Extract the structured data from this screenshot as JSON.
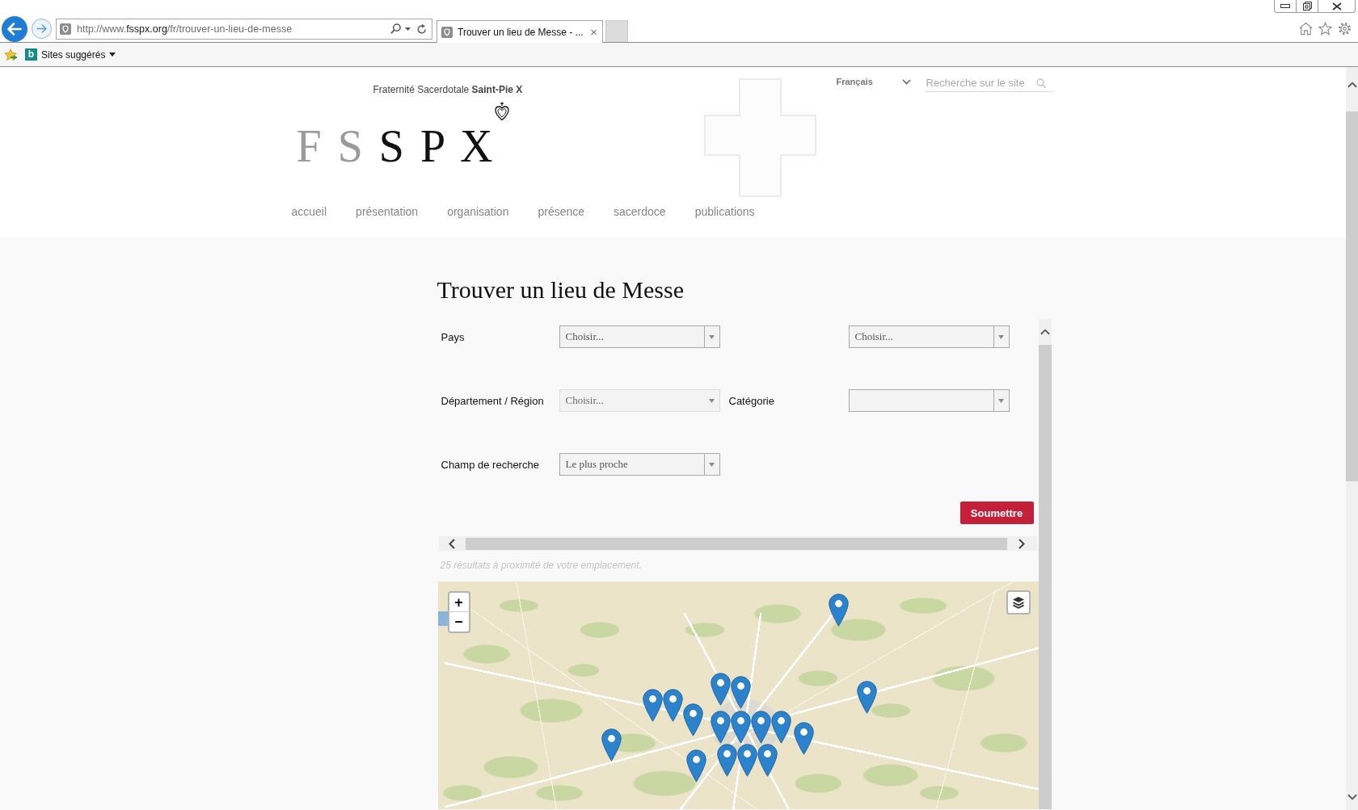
{
  "browser": {
    "address_bar": {
      "url": "http://www.fsspx.org/fr/trouver-un-lieu-de-messe"
    },
    "tabs": [
      {
        "label": "Trouver un lieu de Messe - ...",
        "close": "×",
        "selected": true
      }
    ],
    "favorites_bar": {
      "items": [
        {
          "icon_letter": "b",
          "label": "Sites suggérés"
        }
      ]
    }
  },
  "site_header": {
    "tagline": "Fraternité Sacerdotale **Saint-Pie X**",
    "logo": "F S S P X",
    "language": "Français",
    "search": {
      "placeholder": "Recherche sur le site"
    },
    "nav": [
      {
        "label": "accueil",
        "selected": false
      },
      {
        "label": "présentation",
        "selected": false
      },
      {
        "label": "organisation",
        "selected": false
      },
      {
        "label": "présence",
        "selected": false
      },
      {
        "label": "sacerdoce",
        "selected": false
      },
      {
        "label": "publications",
        "selected": false
      }
    ]
  },
  "page": {
    "title": "Trouver un lieu de Messe",
    "form": {
      "rows": [
        {
          "label": "Pays",
          "select": {
            "value": "Choisir...",
            "disabled": false
          },
          "extra_select": {
            "value": "Choisir...",
            "disabled": false
          }
        },
        {
          "label": "Département / Région",
          "select": {
            "value": "Choisir...",
            "disabled": true
          },
          "extra_label": "Catégorie",
          "extra_select": {
            "disabled": false
          }
        },
        {
          "label": "Champ de recherche",
          "select": {
            "value": "Le plus proche",
            "disabled": false
          }
        }
      ]
    },
    "submit_button": "Soumettre",
    "results_note": "25 résultats à proximité de votre emplacement.",
    "map": {
      "zoom_in": "+",
      "zoom_out": "−"
    }
  }
}
